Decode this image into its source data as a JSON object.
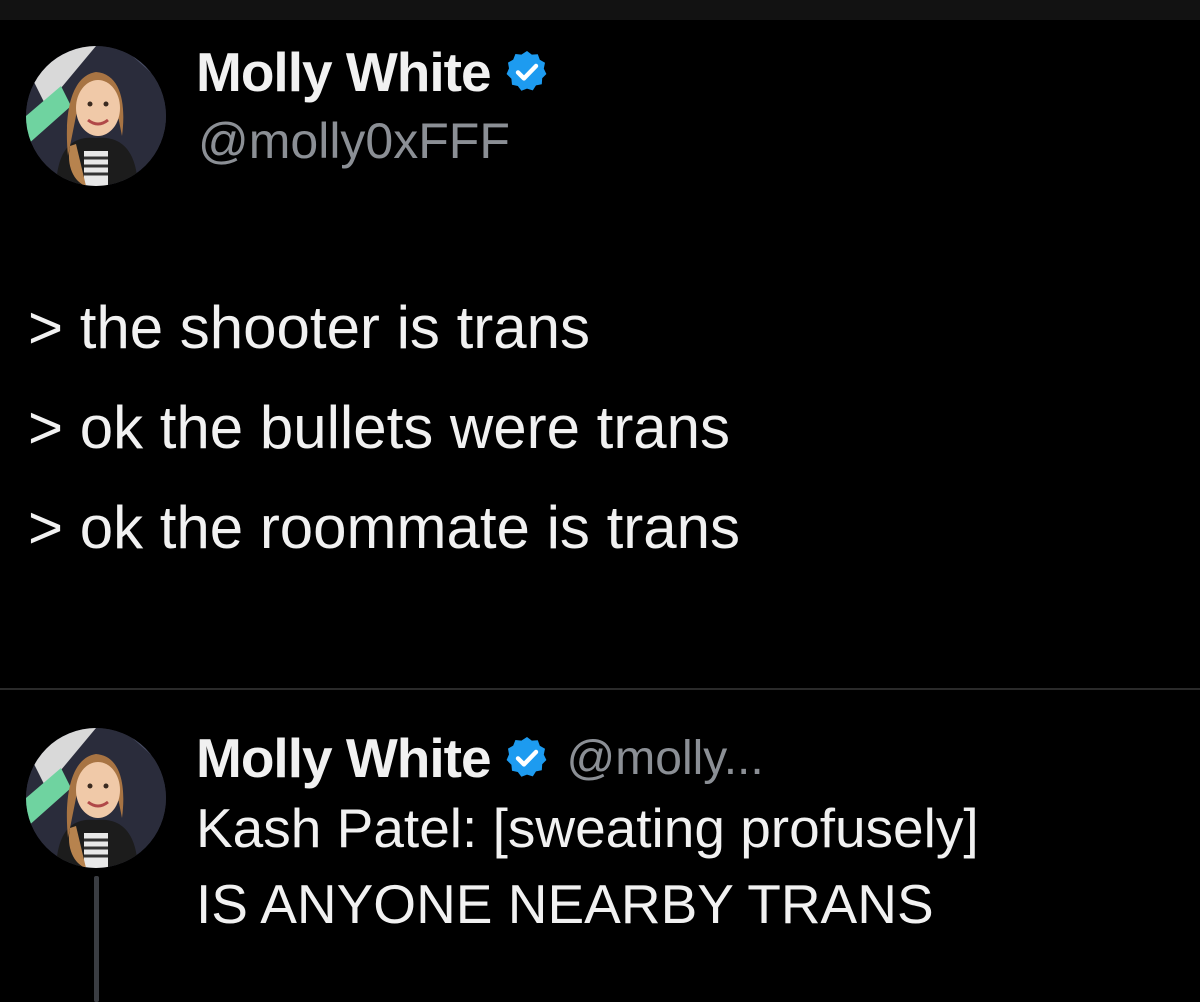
{
  "tweet": {
    "display_name": "Molly White",
    "handle": "@molly0xFFF",
    "lines": [
      "> the shooter is trans",
      "> ok the bullets were trans",
      "> ok the roommate is trans"
    ]
  },
  "reply": {
    "display_name": "Molly White",
    "handle": "@molly...",
    "lines": [
      "Kash Patel: [sweating profusely]",
      "IS ANYONE NEARBY TRANS"
    ]
  },
  "icons": {
    "verified": "verified-badge-icon",
    "avatar": "profile-photo"
  },
  "colors": {
    "background": "#000000",
    "text": "#f1f1f1",
    "secondary_text": "#8b8f95",
    "verified": "#1d9bf0",
    "divider": "#2a2a2a"
  }
}
